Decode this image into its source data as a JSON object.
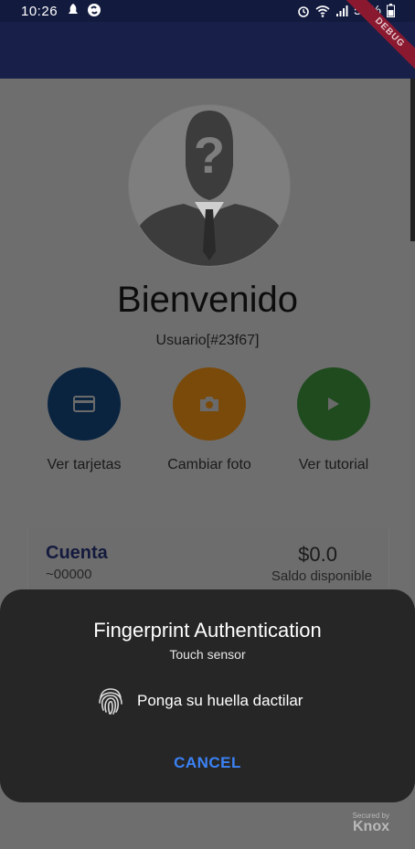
{
  "status_bar": {
    "time": "10:26",
    "battery": "58%",
    "icons_left": [
      "notification-icon",
      "shazam-icon"
    ],
    "icons_right": [
      "alarm-icon",
      "wifi-icon",
      "signal-icon",
      "battery-icon"
    ]
  },
  "app_bar": {
    "debug_ribbon": "DEBUG"
  },
  "profile": {
    "welcome": "Bienvenido",
    "user_id": "Usuario[#23f67]"
  },
  "actions": [
    {
      "label": "Ver tarjetas",
      "icon": "credit-card-icon",
      "color": "#0a2440"
    },
    {
      "label": "Cambiar foto",
      "icon": "camera-icon",
      "color": "#7a4a0a"
    },
    {
      "label": "Ver tutorial",
      "icon": "play-icon",
      "color": "#1f4b1f"
    }
  ],
  "account_card": {
    "title": "Cuenta",
    "number": "~00000",
    "amount": "$0.0",
    "caption": "Saldo disponible"
  },
  "dialog": {
    "title": "Fingerprint Authentication",
    "subtitle": "Touch sensor",
    "prompt": "Ponga su huella dactilar",
    "cancel": "CANCEL"
  },
  "knox": {
    "small": "Secured by",
    "brand": "Knox"
  },
  "colors": {
    "status_bar": "#121a3e",
    "app_bar": "#18204a",
    "scrim": "#6e6e6e",
    "sheet": "#262626",
    "cancel_text": "#3b82f6"
  }
}
